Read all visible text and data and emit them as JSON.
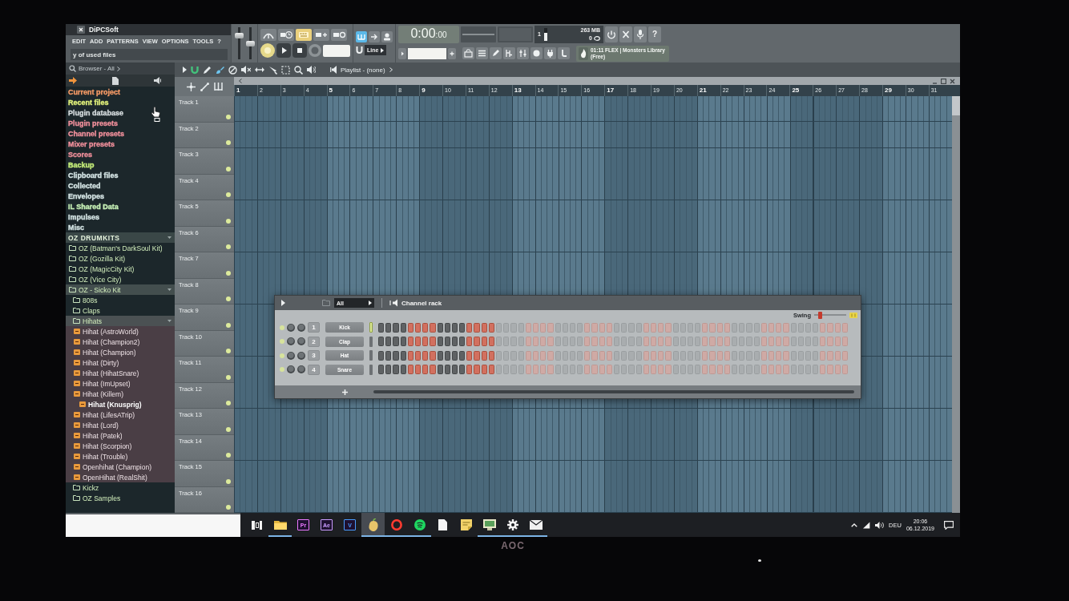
{
  "window": {
    "title": "DiPCSoft"
  },
  "menu": [
    "EDIT",
    "ADD",
    "PATTERNS",
    "VIEW",
    "OPTIONS",
    "TOOLS",
    "?"
  ],
  "hint_bar": "y of used files",
  "toolbar": {
    "sliders": [
      {
        "level": 0.8
      },
      {
        "level": 0.5
      }
    ],
    "snap": "Line",
    "time": {
      "main": "0:00",
      "sub": ":00"
    },
    "cpu": {
      "reading": "1",
      "level": 0.6
    },
    "memory": "263 MB",
    "polyphony": "0",
    "help": "?",
    "news": "01:11 FLEX | Monsters Library (Free)"
  },
  "browser": {
    "title": "Browser - All",
    "items": [
      {
        "label": "Current project",
        "kind": "location",
        "color": "#f59a66",
        "expanded": false,
        "selected": false
      },
      {
        "label": "Recent files",
        "kind": "location",
        "color": "#e0f07a",
        "expanded": false,
        "selected": false
      },
      {
        "label": "Plugin database",
        "kind": "location",
        "color": "#d5dcde",
        "expanded": false,
        "selected": false
      },
      {
        "label": "Plugin presets",
        "kind": "location",
        "color": "#f2909c",
        "expanded": false,
        "selected": false
      },
      {
        "label": "Channel presets",
        "kind": "location",
        "color": "#f2909c",
        "expanded": false,
        "selected": false
      },
      {
        "label": "Mixer presets",
        "kind": "location",
        "color": "#f2909c",
        "expanded": false,
        "selected": false
      },
      {
        "label": "Scores",
        "kind": "location",
        "color": "#f2909c",
        "expanded": false,
        "selected": false
      },
      {
        "label": "Backup",
        "kind": "location",
        "color": "#c6ef7a",
        "expanded": false,
        "selected": false
      },
      {
        "label": "Clipboard files",
        "kind": "location",
        "color": "#d6e6e6",
        "expanded": false,
        "selected": false
      },
      {
        "label": "Collected",
        "kind": "location",
        "color": "#d6e6e6",
        "expanded": false,
        "selected": false
      },
      {
        "label": "Envelopes",
        "kind": "location",
        "color": "#d6e6e6",
        "expanded": false,
        "selected": false
      },
      {
        "label": "IL Shared Data",
        "kind": "location",
        "color": "#c5efb5",
        "expanded": false,
        "selected": false
      },
      {
        "label": "Impulses",
        "kind": "location",
        "color": "#d6e6e6",
        "expanded": false,
        "selected": false
      },
      {
        "label": "Misc",
        "kind": "location",
        "color": "#d6e6e6",
        "expanded": false,
        "selected": false
      },
      {
        "label": "OZ DRUMKITS",
        "kind": "group",
        "expanded": true,
        "selected": false,
        "children": [
          {
            "label": "OZ (Batman's DarkSoul Kit)",
            "kind": "folder",
            "expanded": false,
            "selected": false
          },
          {
            "label": "OZ (Gozilla Kit)",
            "kind": "folder",
            "expanded": false,
            "selected": false
          },
          {
            "label": "OZ (MagicCity Kit)",
            "kind": "folder",
            "expanded": false,
            "selected": false
          },
          {
            "label": "OZ (Vice City)",
            "kind": "folder",
            "expanded": false,
            "selected": false
          },
          {
            "label": "OZ - Sicko Kit",
            "kind": "folder",
            "expanded": true,
            "selected": false,
            "children": [
              {
                "label": "808s",
                "kind": "folder",
                "expanded": false,
                "selected": false
              },
              {
                "label": "Claps",
                "kind": "folder",
                "expanded": false,
                "selected": false
              },
              {
                "label": "Hihats",
                "kind": "folder",
                "expanded": true,
                "selected": false,
                "children": [
                  {
                    "label": "Hihat (AstroWorld)",
                    "kind": "file",
                    "selected": false
                  },
                  {
                    "label": "Hihat (Champion2)",
                    "kind": "file",
                    "selected": false
                  },
                  {
                    "label": "Hihat (Champion)",
                    "kind": "file",
                    "selected": false
                  },
                  {
                    "label": "Hihat (Dirty)",
                    "kind": "file",
                    "selected": false
                  },
                  {
                    "label": "Hihat (HihatSnare)",
                    "kind": "file",
                    "selected": false
                  },
                  {
                    "label": "Hihat (ImUpset)",
                    "kind": "file",
                    "selected": false
                  },
                  {
                    "label": "Hihat (Killem)",
                    "kind": "file",
                    "selected": false
                  },
                  {
                    "label": "Hihat (Knusprig)",
                    "kind": "file",
                    "selected": true
                  },
                  {
                    "label": "Hihat (LifesATrip)",
                    "kind": "file",
                    "selected": false
                  },
                  {
                    "label": "Hihat (Lord)",
                    "kind": "file",
                    "selected": false
                  },
                  {
                    "label": "Hihat (Patek)",
                    "kind": "file",
                    "selected": false
                  },
                  {
                    "label": "Hihat (Scorpion)",
                    "kind": "file",
                    "selected": false
                  },
                  {
                    "label": "Hihat (Trouble)",
                    "kind": "file",
                    "selected": false
                  },
                  {
                    "label": "Openhihat (Champion)",
                    "kind": "file",
                    "selected": false
                  },
                  {
                    "label": "OpenHihat (RealShit)",
                    "kind": "file",
                    "selected": false
                  }
                ]
              },
              {
                "label": "Kickz",
                "kind": "folder",
                "expanded": false,
                "selected": false
              },
              {
                "label": "OZ Samples",
                "kind": "folder",
                "expanded": false,
                "selected": false
              }
            ]
          }
        ]
      }
    ]
  },
  "playlist": {
    "title": "Playlist - (none)",
    "bars": [
      "1",
      "2",
      "3",
      "4",
      "5",
      "6",
      "7",
      "8",
      "9",
      "10",
      "11",
      "12",
      "13",
      "14",
      "15",
      "16",
      "17",
      "18",
      "19",
      "20",
      "21",
      "22",
      "23",
      "24",
      "25",
      "26",
      "27",
      "28",
      "29",
      "30",
      "31"
    ],
    "tracks": [
      {
        "name": "Track 1",
        "enabled": true
      },
      {
        "name": "Track 2",
        "enabled": true
      },
      {
        "name": "Track 3",
        "enabled": true
      },
      {
        "name": "Track 4",
        "enabled": true
      },
      {
        "name": "Track 5",
        "enabled": true
      },
      {
        "name": "Track 6",
        "enabled": true
      },
      {
        "name": "Track 7",
        "enabled": true
      },
      {
        "name": "Track 8",
        "enabled": true
      },
      {
        "name": "Track 9",
        "enabled": true
      },
      {
        "name": "Track 10",
        "enabled": true
      },
      {
        "name": "Track 11",
        "enabled": true
      },
      {
        "name": "Track 12",
        "enabled": true
      },
      {
        "name": "Track 13",
        "enabled": true
      },
      {
        "name": "Track 14",
        "enabled": true
      },
      {
        "name": "Track 15",
        "enabled": true
      },
      {
        "name": "Track 16",
        "enabled": true
      }
    ]
  },
  "channel_rack": {
    "filter": "All",
    "title": "Channel rack",
    "swing": {
      "label": "Swing",
      "level": 0.15
    },
    "channels": [
      {
        "number": "1",
        "name": "Kick",
        "enabled": true,
        "selected": true
      },
      {
        "number": "2",
        "name": "Clap",
        "enabled": true,
        "selected": false
      },
      {
        "number": "3",
        "name": "Hat",
        "enabled": true,
        "selected": false
      },
      {
        "number": "4",
        "name": "Snare",
        "enabled": true,
        "selected": false
      }
    ]
  },
  "taskbar": {
    "apps": [
      {
        "kind": "folder",
        "running": true,
        "selected": false
      },
      {
        "kind": "letter-tile",
        "label": "Pr",
        "color": "#ea77ff",
        "running": false,
        "selected": false
      },
      {
        "kind": "letter-tile",
        "label": "Ae",
        "color": "#c99bff",
        "running": false,
        "selected": false
      },
      {
        "kind": "letter-tile",
        "label": "V",
        "color": "#4a9bff",
        "running": false,
        "selected": false
      },
      {
        "kind": "fruit",
        "running": true,
        "selected": true
      },
      {
        "kind": "ring",
        "running": true,
        "selected": false
      },
      {
        "kind": "striped-disc",
        "running": true,
        "selected": false
      },
      {
        "kind": "document",
        "running": false,
        "selected": false
      },
      {
        "kind": "note",
        "running": false,
        "selected": false
      },
      {
        "kind": "monitor",
        "running": true,
        "selected": false
      },
      {
        "kind": "gear",
        "running": true,
        "selected": false
      },
      {
        "kind": "mail",
        "running": true,
        "selected": false
      }
    ],
    "tray": {
      "language": "DEU",
      "time": "20:06",
      "date": "06.12.2019"
    }
  },
  "monitor": {
    "brand": "AOC"
  }
}
